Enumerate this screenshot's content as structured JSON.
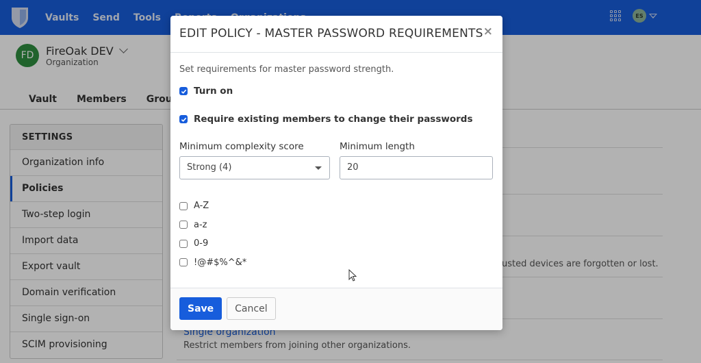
{
  "nav": {
    "links": [
      "Vaults",
      "Send",
      "Tools",
      "Reports",
      "Organizations"
    ],
    "user_initials": "ES",
    "apps_icon": "product-switcher-grid-icon",
    "logo_icon": "shield-logo-icon"
  },
  "org": {
    "initials": "FD",
    "name": "FireOak DEV",
    "subtitle": "Organization",
    "tabs": [
      "Vault",
      "Members",
      "Groups"
    ]
  },
  "settings": {
    "heading": "SETTINGS",
    "items": [
      {
        "label": "Organization info",
        "active": false
      },
      {
        "label": "Policies",
        "active": true
      },
      {
        "label": "Two-step login",
        "active": false
      },
      {
        "label": "Import data",
        "active": false
      },
      {
        "label": "Export vault",
        "active": false
      },
      {
        "label": "Domain verification",
        "active": false
      },
      {
        "label": "Single sign-on",
        "active": false
      },
      {
        "label": "SCIM provisioning",
        "active": false
      }
    ]
  },
  "policies_background": {
    "partial_desc": "usted devices are forgotten or lost.",
    "single_org": {
      "title": "Single organization",
      "desc": "Restrict members from joining other organizations."
    }
  },
  "modal": {
    "title": "EDIT POLICY - MASTER PASSWORD REQUIREMENTS",
    "close_label": "×",
    "description": "Set requirements for master password strength.",
    "turn_on": {
      "label": "Turn on",
      "checked": true
    },
    "require_change": {
      "label": "Require existing members to change their passwords",
      "checked": true
    },
    "complexity": {
      "label": "Minimum complexity score",
      "value": "Strong (4)"
    },
    "min_length": {
      "label": "Minimum length",
      "value": "20"
    },
    "char_options": [
      {
        "label": "A-Z",
        "checked": false
      },
      {
        "label": "a-z",
        "checked": false
      },
      {
        "label": "0-9",
        "checked": false
      },
      {
        "label": "!@#$%^&*",
        "checked": false
      }
    ],
    "save_label": "Save",
    "cancel_label": "Cancel"
  },
  "colors": {
    "brand": "#175ddc",
    "org_avatar": "#2f8f3f"
  }
}
